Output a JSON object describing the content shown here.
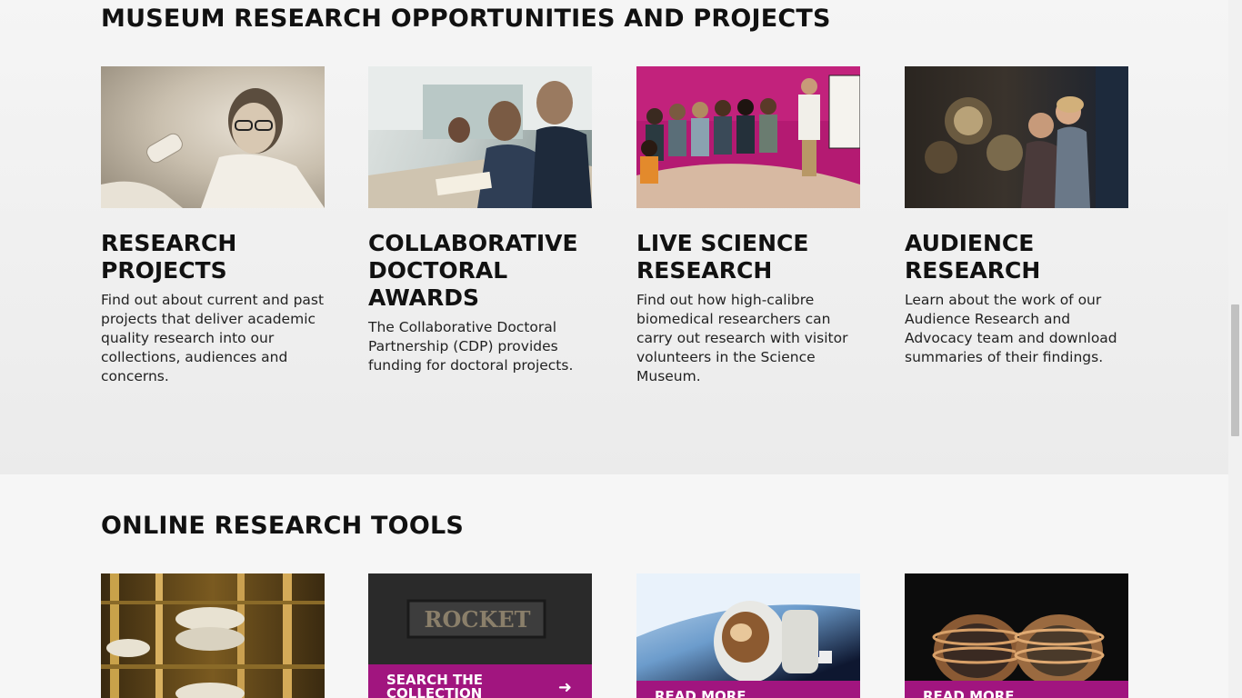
{
  "research": {
    "heading": "MUSEUM RESEARCH OPPORTUNITIES AND PROJECTS",
    "cards": [
      {
        "title": "RESEARCH PROJECTS",
        "description": "Find out about current and past projects that deliver academic quality research into our collections, audiences and concerns."
      },
      {
        "title": "COLLABORATIVE DOCTORAL AWARDS",
        "description": "The Collaborative Doctoral Partnership (CDP) provides funding for doctoral projects."
      },
      {
        "title": "LIVE SCIENCE RESEARCH",
        "description": "Find out how high-calibre biomedical researchers can carry out research with visitor volunteers in the Science Museum."
      },
      {
        "title": "AUDIENCE RESEARCH",
        "description": "Learn about the work of our Audience Research and Advocacy team and download summaries of their findings."
      }
    ]
  },
  "tools": {
    "heading": "ONLINE RESEARCH TOOLS",
    "rocket_text": "ROCKET",
    "cards": [
      {
        "button": ""
      },
      {
        "button": "SEARCH THE COLLECTION"
      },
      {
        "button": "READ MORE"
      },
      {
        "button": "READ MORE"
      }
    ]
  },
  "colors": {
    "accent": "#a1157f",
    "heading": "#111111",
    "background": "#f6f6f6"
  }
}
